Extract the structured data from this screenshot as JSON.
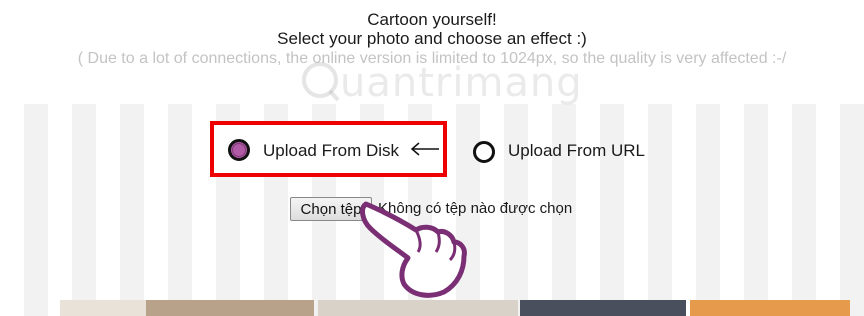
{
  "header": {
    "title": "Cartoon yourself!",
    "subtitle": "Select your photo and choose an effect :)",
    "note": "( Due to a lot of connections, the online version is limited to 1024px, so the quality is very affected :-/"
  },
  "watermark": {
    "text": "uantrimang"
  },
  "upload_options": {
    "disk": {
      "label": "Upload From Disk",
      "selected": true
    },
    "url": {
      "label": "Upload From URL",
      "selected": false
    }
  },
  "file_input": {
    "button_label": "Chọn tệp",
    "status": "Không có tệp nào được chọn"
  },
  "colors": {
    "highlight_border": "#ee0000",
    "radio_fill": "#b15aa6",
    "note_text": "#c3c3c3",
    "stripe": "#f2f2f2"
  },
  "icons": [
    "arrow-left-icon",
    "pointing-hand-icon",
    "watermark-logo-icon"
  ]
}
